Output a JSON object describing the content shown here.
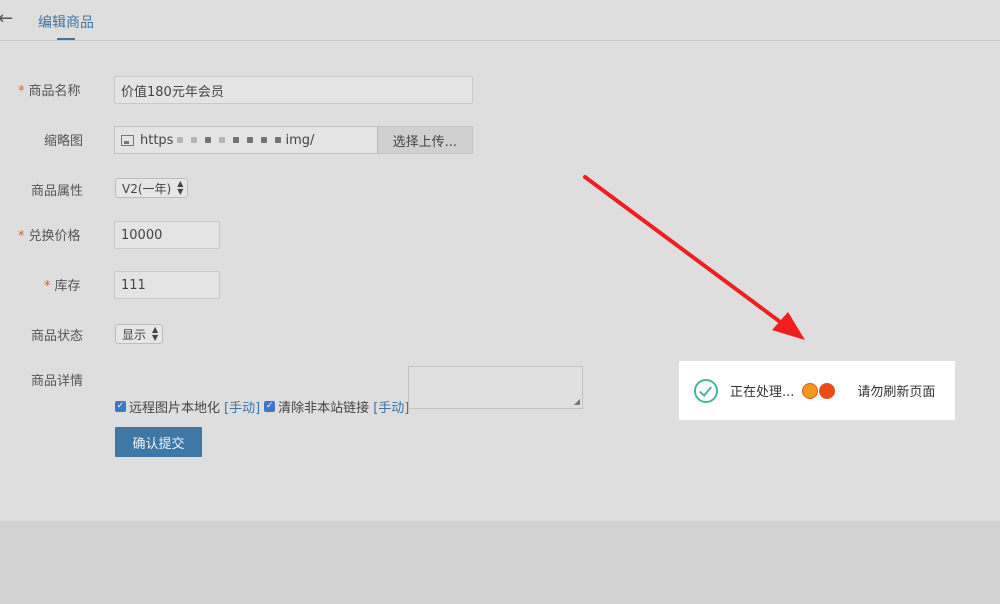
{
  "header": {
    "title": "编辑商品"
  },
  "form": {
    "name": {
      "label": "商品名称",
      "value": "价值180元年会员"
    },
    "thumbnail": {
      "label": "缩略图",
      "path_start": "https",
      "path_end": "img/",
      "upload_label": "选择上传..."
    },
    "attribute": {
      "label": "商品属性",
      "value": "V2(一年)"
    },
    "price": {
      "label": "兑换价格",
      "value": "10000"
    },
    "stock": {
      "label": "库存",
      "value": "111"
    },
    "status": {
      "label": "商品状态",
      "value": "显示"
    },
    "details": {
      "label": "商品详情",
      "check1_label": "远程图片本地化",
      "check1_link": "[手动]",
      "check2_label": "清除非本站链接",
      "check2_link": "[手动]"
    },
    "required_mark": "*",
    "submit_label": "确认提交"
  },
  "toast": {
    "processing": "正在处理...",
    "hint": "请勿刷新页面"
  },
  "colors": {
    "accent": "#3a76a8",
    "toast_check": "#4cb394",
    "annotation_arrow": "#f01e1e"
  }
}
